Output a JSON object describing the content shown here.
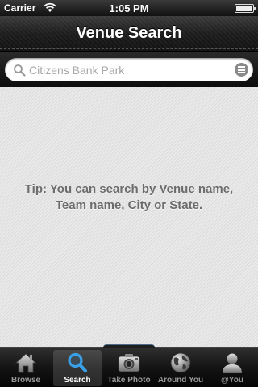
{
  "status_bar": {
    "carrier": "Carrier",
    "time": "1:05 PM"
  },
  "nav": {
    "title": "Venue Search"
  },
  "search": {
    "placeholder": "Citizens Bank Park",
    "value": ""
  },
  "content": {
    "tip": "Tip: You can search by Venue name, Team name, City or State."
  },
  "tab_bar": {
    "selected": "Search",
    "tabs": [
      {
        "label": "Browse",
        "icon": "house-icon"
      },
      {
        "label": "Search",
        "icon": "magnifier-icon"
      },
      {
        "label": "Take Photo",
        "icon": "camera-icon"
      },
      {
        "label": "Around You",
        "icon": "globe-icon"
      },
      {
        "label": "@You",
        "icon": "person-icon"
      }
    ]
  },
  "colors": {
    "bar_dark": "#111111",
    "content_bg": "#e4e4e4",
    "tip_text": "#6c6c6c",
    "selected_icon": "#3aa0e8"
  }
}
